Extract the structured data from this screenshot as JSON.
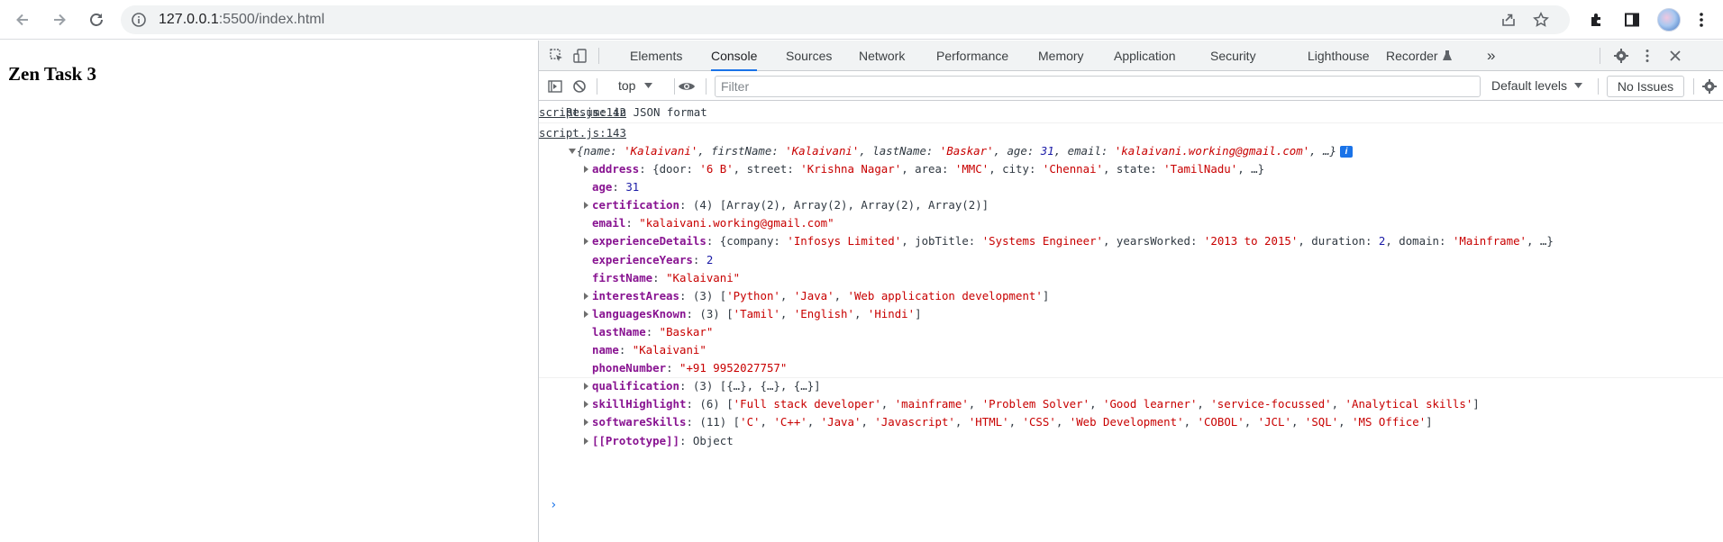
{
  "browser": {
    "url_host": "127.0.0.1",
    "url_rest": ":5500/index.html"
  },
  "page": {
    "heading": "Zen Task 3"
  },
  "devtools": {
    "tabs": [
      "Elements",
      "Console",
      "Sources",
      "Network",
      "Performance",
      "Memory",
      "Application",
      "Security",
      "Lighthouse",
      "Recorder"
    ],
    "active_tab": "Console",
    "more_tabs_glyph": "»",
    "context": "top",
    "filter_placeholder": "Filter",
    "levels": "Default levels",
    "issues": "No Issues"
  },
  "console": {
    "messages": [
      {
        "text": "Resume in JSON format",
        "source": "script.js:142"
      },
      {
        "source": "script.js:143"
      }
    ],
    "object_summary": "{name: 'Kalaivani', firstName: 'Kalaivani', lastName: 'Baskar', age: 31, email: 'kalaivani.working@gmail.com', …}",
    "object_info_badge": "i",
    "properties": [
      {
        "expandable": true,
        "key": "address",
        "value": "{door: '6 B', street: 'Krishna Nagar', area: 'MMC', city: 'Chennai', state: 'TamilNadu', …}"
      },
      {
        "expandable": false,
        "key": "age",
        "value": "31"
      },
      {
        "expandable": true,
        "key": "certification",
        "value": "(4) [Array(2), Array(2), Array(2), Array(2)]"
      },
      {
        "expandable": false,
        "key": "email",
        "value": "\"kalaivani.working@gmail.com\""
      },
      {
        "expandable": true,
        "key": "experienceDetails",
        "value": "{company: 'Infosys Limited', jobTitle: 'Systems Engineer', yearsWorked: '2013 to 2015', duration: 2, domain: 'Mainframe', …}"
      },
      {
        "expandable": false,
        "key": "experienceYears",
        "value": "2"
      },
      {
        "expandable": false,
        "key": "firstName",
        "value": "\"Kalaivani\""
      },
      {
        "expandable": true,
        "key": "interestAreas",
        "value": "(3) ['Python', 'Java', 'Web application development']"
      },
      {
        "expandable": true,
        "key": "languagesKnown",
        "value": "(3) ['Tamil', 'English', 'Hindi']"
      },
      {
        "expandable": false,
        "key": "lastName",
        "value": "\"Baskar\""
      },
      {
        "expandable": false,
        "key": "name",
        "value": "\"Kalaivani\""
      },
      {
        "expandable": false,
        "key": "phoneNumber",
        "value": "\"+91 9952027757\""
      },
      {
        "expandable": true,
        "key": "qualification",
        "value": "(3) [{…}, {…}, {…}]"
      },
      {
        "expandable": true,
        "key": "skillHighlight",
        "value": "(6) ['Full stack developer', 'mainframe', 'Problem Solver', 'Good learner', 'service-focussed', 'Analytical skills']"
      },
      {
        "expandable": true,
        "key": "softwareSkills",
        "value": "(11) ['C', 'C++', 'Java', 'Javascript', 'HTML', 'CSS', 'Web Development', 'COBOL', 'JCL', 'SQL', 'MS Office']"
      },
      {
        "expandable": true,
        "key": "[[Prototype]]",
        "value": "Object"
      }
    ],
    "prompt": "›"
  }
}
